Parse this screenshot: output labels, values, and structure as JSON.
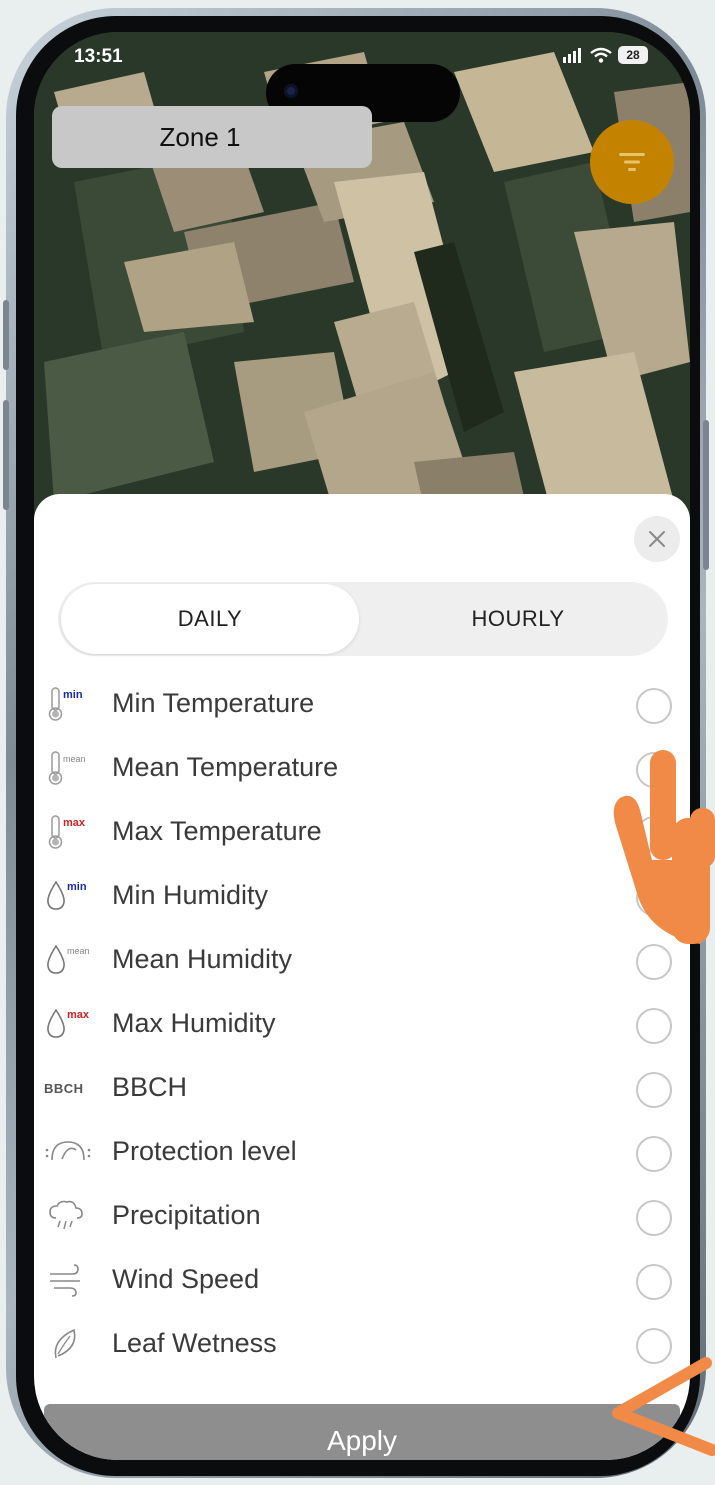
{
  "status_bar": {
    "time": "13:51",
    "battery": "28"
  },
  "header": {
    "zone_label": "Zone 1",
    "filter_icon": "filter-icon"
  },
  "tabs": [
    {
      "label": "DAILY",
      "selected": true
    },
    {
      "label": "HOURLY",
      "selected": false
    }
  ],
  "parameters": [
    {
      "label": "Min Temperature",
      "icon": "thermometer-min-icon",
      "badge": "min",
      "badge_color": "#1a2aa8",
      "selected": false
    },
    {
      "label": "Mean Temperature",
      "icon": "thermometer-mean-icon",
      "badge": "mean",
      "badge_color": "#888888",
      "selected": false
    },
    {
      "label": "Max Temperature",
      "icon": "thermometer-max-icon",
      "badge": "max",
      "badge_color": "#d42020",
      "selected": false
    },
    {
      "label": "Min Humidity",
      "icon": "droplet-min-icon",
      "badge": "min",
      "badge_color": "#1a2aa8",
      "selected": false
    },
    {
      "label": "Mean Humidity",
      "icon": "droplet-mean-icon",
      "badge": "mean",
      "badge_color": "#888888",
      "selected": false
    },
    {
      "label": "Max Humidity",
      "icon": "droplet-max-icon",
      "badge": "max",
      "badge_color": "#d42020",
      "selected": false
    },
    {
      "label": "BBCH",
      "icon": "bbch-icon",
      "badge": "BBCH",
      "badge_color": "#555555",
      "selected": false
    },
    {
      "label": "Protection level",
      "icon": "protection-level-icon",
      "badge": "",
      "selected": false
    },
    {
      "label": "Precipitation",
      "icon": "rain-cloud-icon",
      "badge": "",
      "selected": false
    },
    {
      "label": "Wind Speed",
      "icon": "wind-icon",
      "badge": "",
      "selected": false
    },
    {
      "label": "Leaf Wetness",
      "icon": "leaf-icon",
      "badge": "",
      "selected": false
    }
  ],
  "apply_button": {
    "label": "Apply"
  },
  "colors": {
    "accent_fab": "#c38300",
    "apply_bg": "#8e8e8e",
    "annotation": "#f28a47"
  }
}
